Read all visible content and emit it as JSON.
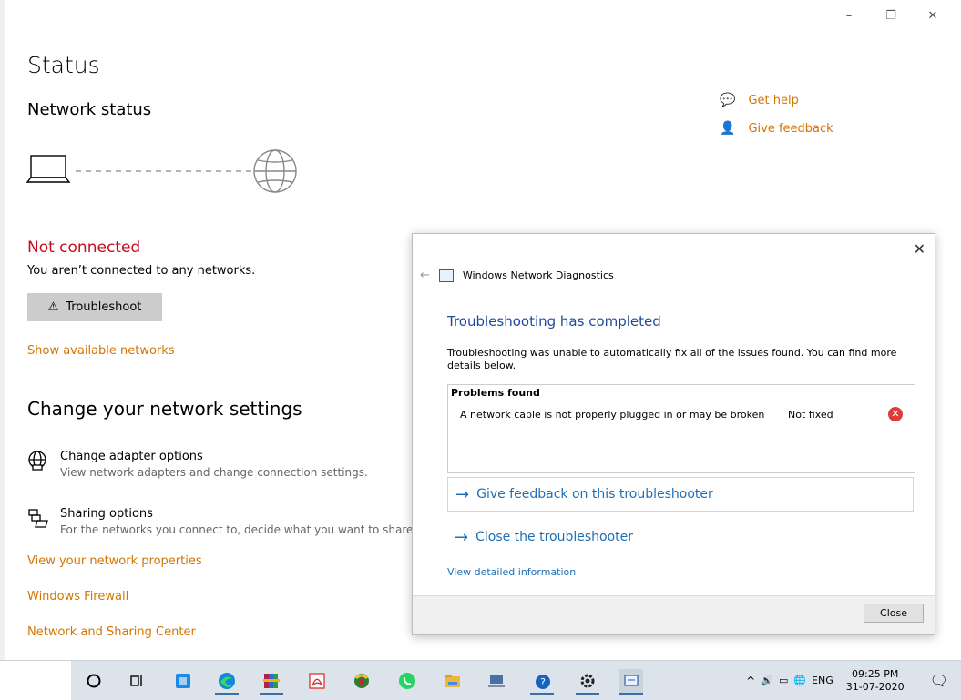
{
  "window": {
    "minimize": "–",
    "restore": "❐",
    "close": "✕"
  },
  "status": {
    "page_title": "Status",
    "section_title": "Network status",
    "connection_state": "Not connected",
    "connection_detail": "You aren’t connected to any networks.",
    "troubleshoot_label": "Troubleshoot",
    "show_networks": "Show available networks"
  },
  "help": {
    "get_help": "Get help",
    "give_feedback": "Give feedback"
  },
  "change": {
    "title": "Change your network settings",
    "adapter_title": "Change adapter options",
    "adapter_desc": "View network adapters and change connection settings.",
    "sharing_title": "Sharing options",
    "sharing_desc": "For the networks you connect to, decide what you want to share.",
    "links": [
      "View your network properties",
      "Windows Firewall",
      "Network and Sharing Center"
    ]
  },
  "dialog": {
    "app_title": "Windows Network Diagnostics",
    "heading": "Troubleshooting has completed",
    "paragraph": "Troubleshooting was unable to automatically fix all of the issues found. You can find more details below.",
    "problems_title": "Problems found",
    "problem_desc": "A network cable is not properly plugged in or may be broken",
    "problem_status": "Not fixed",
    "cmd_feedback": "Give feedback on this troubleshooter",
    "cmd_close": "Close the troubleshooter",
    "detail_link": "View detailed information",
    "close_button": "Close"
  },
  "taskbar": {
    "language": "ENG",
    "time": "09:25 PM",
    "date": "31-07-2020"
  }
}
